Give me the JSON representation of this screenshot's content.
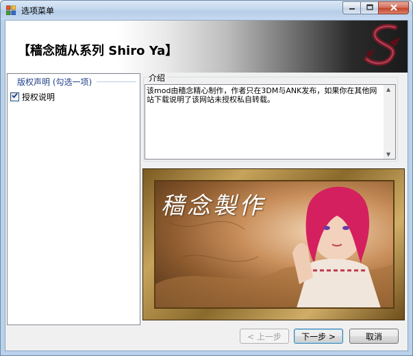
{
  "window": {
    "title": "选项菜单"
  },
  "banner": {
    "title": "【穑念随从系列 Shiro Ya】"
  },
  "options_panel": {
    "group_header": "版权声明 (勾选一项)",
    "options": [
      {
        "label": "授权说明",
        "checked": true
      }
    ]
  },
  "intro": {
    "label": "介绍",
    "text": "该mod由穑念精心制作，作者只在3DM与ANK发布，如果你在其他网站下载说明了该网站未授权私自转载。"
  },
  "picture": {
    "caption": "穑念製作"
  },
  "buttons": {
    "back": "< 上一步",
    "next": "下一步 >",
    "cancel": "取消"
  },
  "colors": {
    "title_bar": "#c3d7ee",
    "group_header_text": "#1e3f8a",
    "close_button": "#c3452c"
  },
  "icons": {
    "app": "app-icon",
    "minimize": "minimize-icon",
    "maximize": "maximize-icon",
    "close": "close-icon",
    "checkbox": "checkmark-icon"
  }
}
